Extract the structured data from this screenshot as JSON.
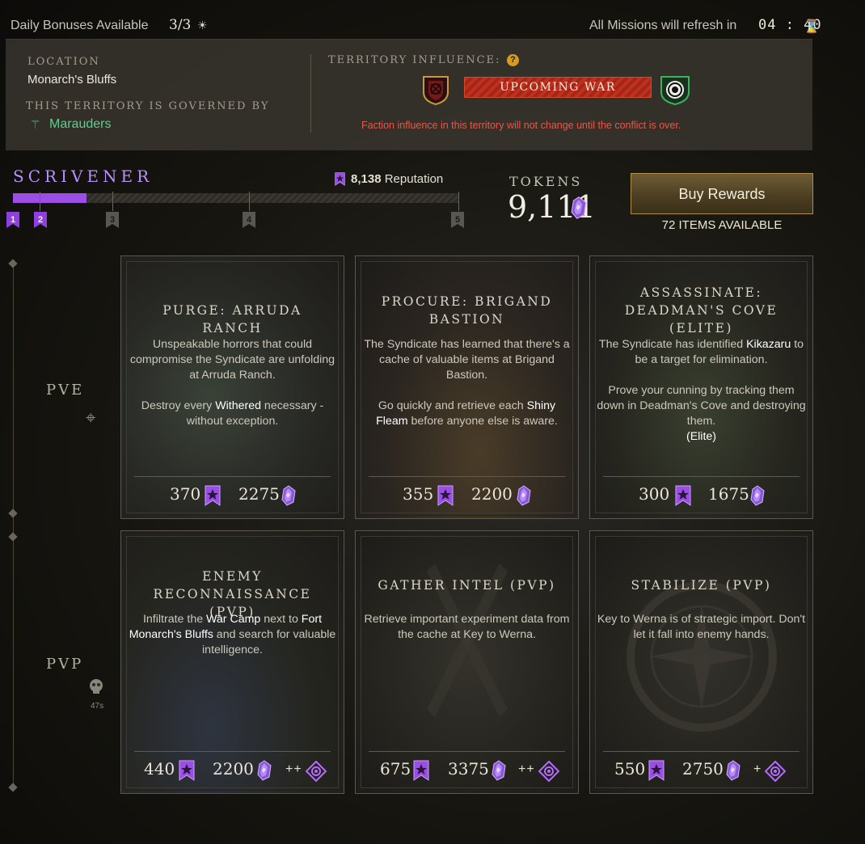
{
  "topbar": {
    "bonus_label": "Daily Bonuses Available",
    "bonus_count": "3/3",
    "refresh_label": "All Missions will refresh in",
    "refresh_time": "04 : 40"
  },
  "location": {
    "title": "LOCATION",
    "name": "Monarch's Bluffs",
    "governed_title": "THIS TERRITORY IS GOVERNED BY",
    "faction": "Marauders",
    "influence_title": "TERRITORY INFLUENCE:",
    "help": "?",
    "banner": "UPCOMING WAR",
    "note": "Faction influence in this territory will not change until the conflict is over."
  },
  "faction_standing": {
    "name": "SCRIVENER",
    "reputation_value": "8,138",
    "reputation_label": "Reputation",
    "progress_fraction": 0.165,
    "ranks": [
      "1",
      "2",
      "3",
      "4",
      "5"
    ]
  },
  "tokens": {
    "title": "TOKENS",
    "value": "9,111"
  },
  "shop": {
    "button": "Buy Rewards",
    "items_available": "72 ITEMS AVAILABLE"
  },
  "rows": {
    "pve_label": "PVE",
    "pvp_label": "PVP",
    "pvp_timer": "47s"
  },
  "missions": [
    {
      "title": "PURGE: ARRUDA RANCH",
      "desc1": "Unspeakable horrors that could compromise the Syndicate are unfolding at Arruda Ranch.",
      "desc2a": "Destroy every ",
      "desc2_hl": "Withered",
      "desc2b": " necessary - without exception.",
      "rep": "370",
      "tokens": "2275"
    },
    {
      "title": "PROCURE: BRIGAND BASTION",
      "desc1": "The Syndicate has learned that there's a cache of valuable items at Brigand Bastion.",
      "desc2a": "Go quickly and retrieve each ",
      "desc2_hl": "Shiny Fleam",
      "desc2b": " before anyone else is aware.",
      "rep": "355",
      "tokens": "2200"
    },
    {
      "title": "ASSASSINATE: DEADMAN'S COVE (ELITE)",
      "desc1a": "The Syndicate has identified ",
      "desc1_hl": "Kikazaru",
      "desc1b": " to be a target for elimination.",
      "desc2": "Prove your cunning by tracking them down in Deadman's Cove and destroying them.",
      "desc3": "(Elite)",
      "rep": "300",
      "tokens": "1675"
    },
    {
      "title": "ENEMY RECONNAISSANCE (PVP)",
      "desc_a": "Infiltrate the ",
      "desc_hl1": "War Camp",
      "desc_b": " next to ",
      "desc_hl2": "Fort Monarch's Bluffs",
      "desc_c": " and search for valuable intelligence.",
      "rep": "440",
      "tokens": "2200",
      "bonus": "++"
    },
    {
      "title": "GATHER INTEL (PVP)",
      "desc": "Retrieve important experiment data from the cache at Key to Werna.",
      "rep": "675",
      "tokens": "3375",
      "bonus": "++"
    },
    {
      "title": "STABILIZE (PVP)",
      "desc": "Key to Werna is of strategic import. Don't let it fall into enemy hands.",
      "rep": "550",
      "tokens": "2750",
      "bonus": "+"
    }
  ],
  "colors": {
    "accent_purple": "#9b4de6",
    "faction_green": "#5cd08a",
    "war_red": "#c0301e",
    "note_red": "#e8584a"
  }
}
